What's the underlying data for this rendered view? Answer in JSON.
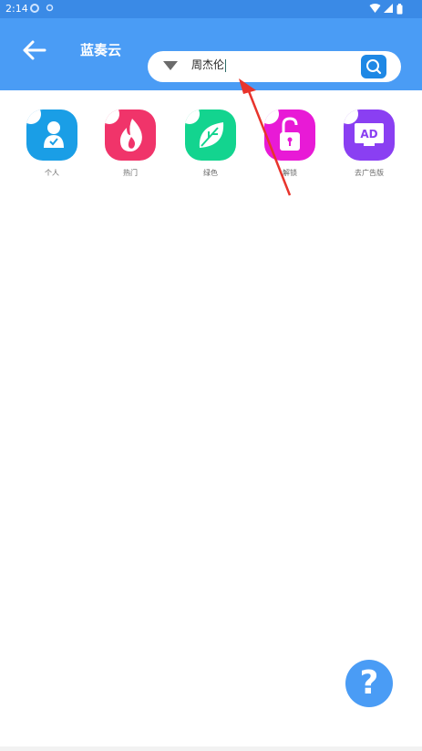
{
  "status_bar": {
    "time": "2:14"
  },
  "app_bar": {
    "title": "蓝奏云"
  },
  "search": {
    "query": "周杰伦"
  },
  "categories": [
    {
      "label": "个人",
      "icon": "person-icon",
      "color": "#1a9ee6"
    },
    {
      "label": "热门",
      "icon": "fire-icon",
      "color": "#f0346a"
    },
    {
      "label": "绿色",
      "icon": "leaf-icon",
      "color": "#13d48f"
    },
    {
      "label": "解锁",
      "icon": "unlock-icon",
      "color": "#e81ad6"
    },
    {
      "label": "去广告版",
      "icon": "ad-icon",
      "color": "#8a3ff2"
    }
  ],
  "help": {
    "label": "?"
  },
  "colors": {
    "appbar": "#4a9cf5",
    "statusbar": "#3a8ae6",
    "search_button": "#1e88e5",
    "annotation": "#e8342c"
  }
}
